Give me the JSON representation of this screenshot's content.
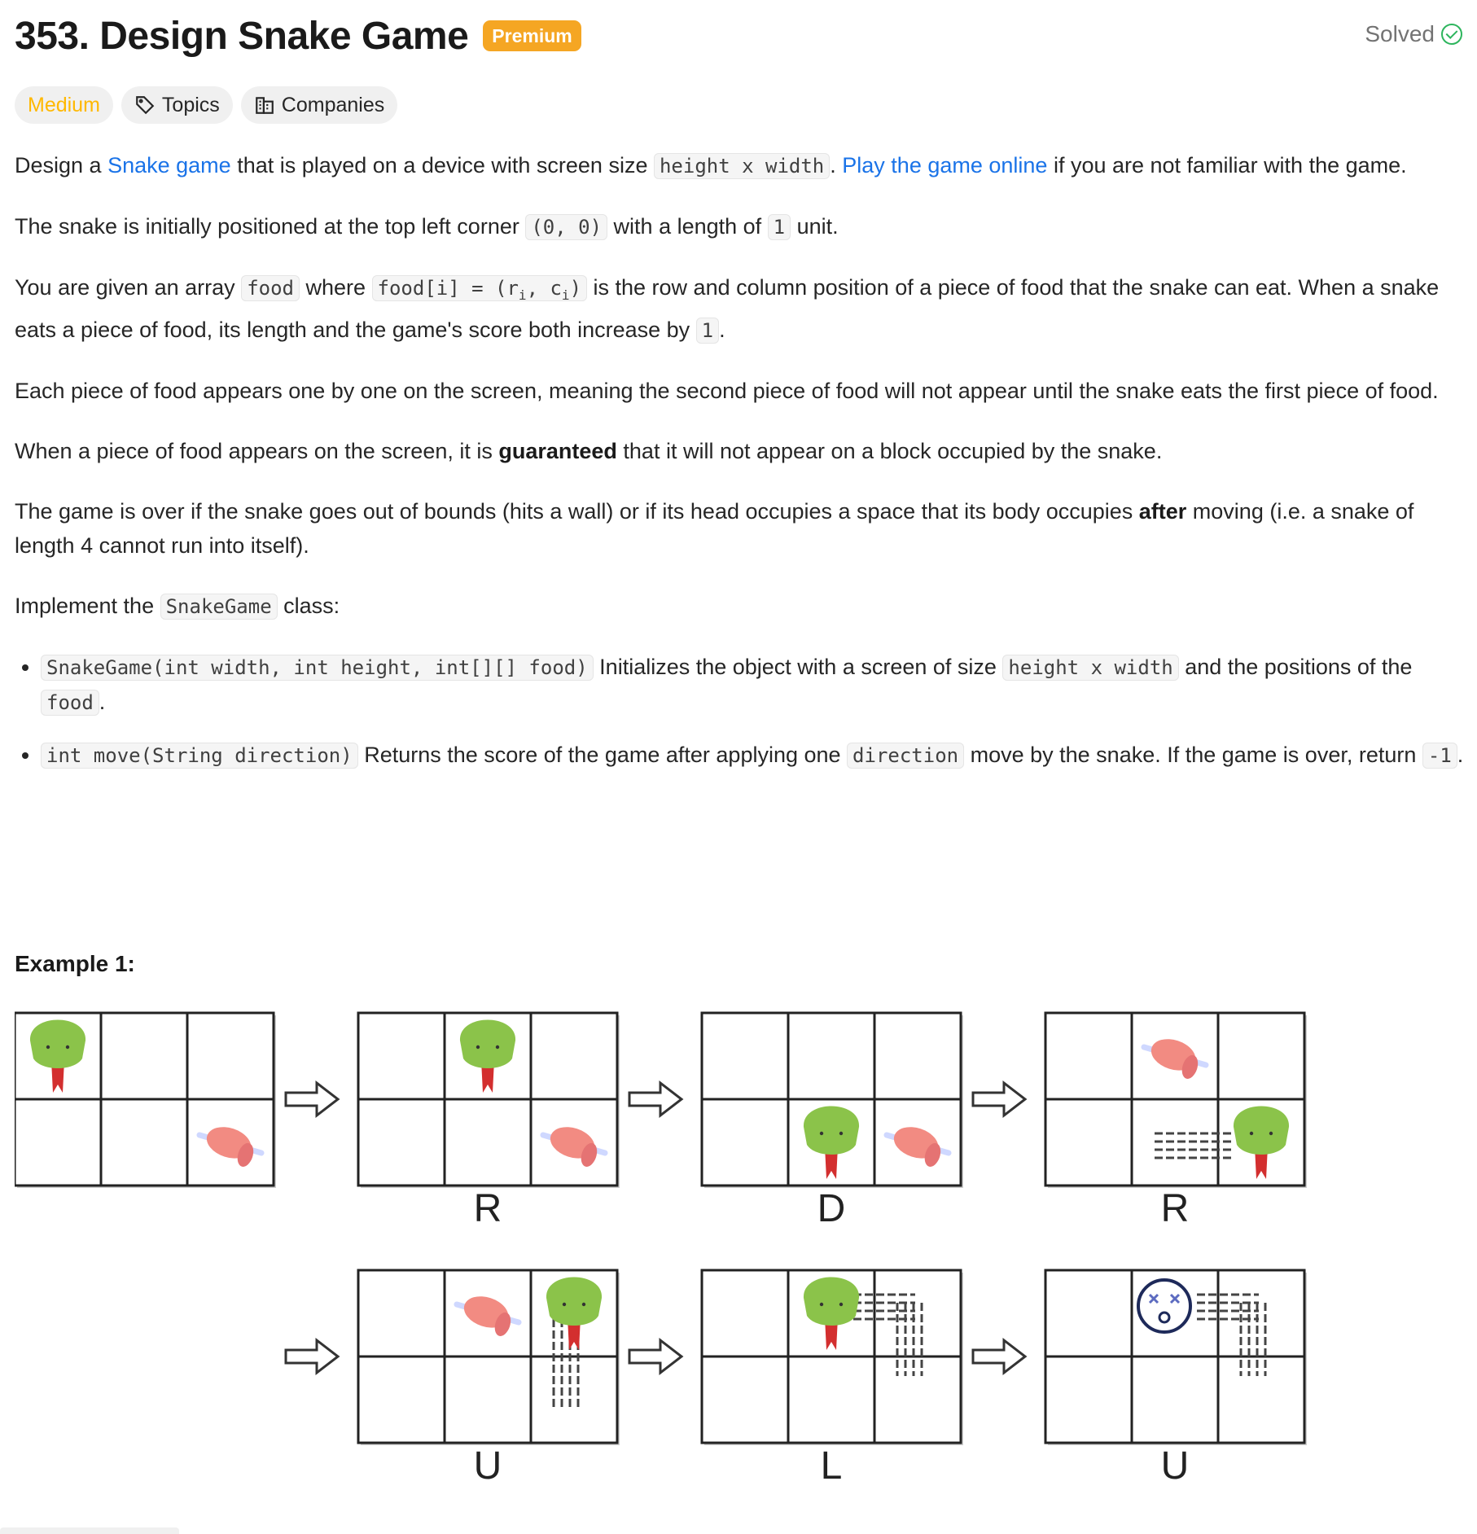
{
  "problem": {
    "title": "353. Design Snake Game",
    "premium_label": "Premium",
    "status": "Solved"
  },
  "tags": {
    "difficulty": "Medium",
    "topics": "Topics",
    "companies": "Companies"
  },
  "description": {
    "p1": {
      "a": "Design a ",
      "link1": "Snake game",
      "b": " that is played on a device with screen size ",
      "code1": "height x width",
      "c": ". ",
      "link2": "Play the game online",
      "d": " if you are not familiar with the game."
    },
    "p2": {
      "a": "The snake is initially positioned at the top left corner ",
      "code1": "(0, 0)",
      "b": " with a length of ",
      "code2": "1",
      "c": " unit."
    },
    "p3": {
      "a": "You are given an array ",
      "code1": "food",
      "b": " where ",
      "code2a": "food[i] = (r",
      "sub1": "i",
      "code2b": ", c",
      "sub2": "i",
      "code2c": ")",
      "c": " is the row and column position of a piece of food that the snake can eat. When a snake eats a piece of food, its length and the game's score both increase by ",
      "code3": "1",
      "d": "."
    },
    "p4": "Each piece of food appears one by one on the screen, meaning the second piece of food will not appear until the snake eats the first piece of food.",
    "p5": {
      "a": "When a piece of food appears on the screen, it is ",
      "bold": "guaranteed",
      "b": " that it will not appear on a block occupied by the snake."
    },
    "p6": {
      "a": "The game is over if the snake goes out of bounds (hits a wall) or if its head occupies a space that its body occupies ",
      "bold": "after",
      "b": " moving (i.e. a snake of length 4 cannot run into itself)."
    },
    "p7": {
      "a": "Implement the ",
      "code1": "SnakeGame",
      "b": " class:"
    },
    "li1": {
      "code1": "SnakeGame(int width, int height, int[][] food)",
      "a": " Initializes the object with a screen of size ",
      "code2": "height x width",
      "b": " and the positions of the ",
      "code3": "food",
      "c": "."
    },
    "li2": {
      "code1": "int move(String direction)",
      "a": " Returns the score of the game after applying one ",
      "code2": "direction",
      "b": " move by the snake. If the game is over, return ",
      "code3": "-1",
      "c": "."
    }
  },
  "example": {
    "title": "Example 1:",
    "moves": [
      "R",
      "D",
      "R",
      "U",
      "L",
      "U"
    ]
  },
  "colors": {
    "link": "#1a73e8",
    "premium": "#f5a623",
    "medium": "#ffb800",
    "solved": "#2db55d",
    "snake": "#8bc34a",
    "tongue": "#d32f2f",
    "food": "#f28b82"
  }
}
